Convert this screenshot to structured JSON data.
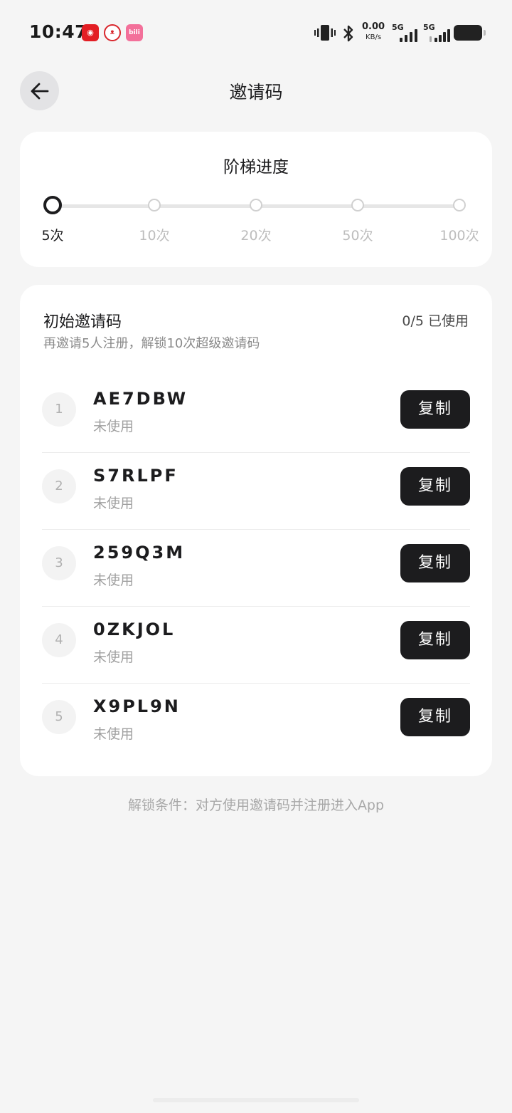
{
  "status_bar": {
    "time": "10:47",
    "apps": [
      {
        "name": "netease-music-icon",
        "glyph": "◉"
      },
      {
        "name": "cat-app-icon",
        "glyph": "ᴥ"
      },
      {
        "name": "bilibili-icon",
        "glyph": "bili"
      }
    ],
    "net_speed": "0.00",
    "net_speed_unit": "KB/s",
    "sim1": "5G",
    "sim2": "5G"
  },
  "header": {
    "title": "邀请码"
  },
  "ladder": {
    "title": "阶梯进度",
    "current_step_index": 0,
    "steps": [
      "5次",
      "10次",
      "20次",
      "50次",
      "100次"
    ]
  },
  "codes": {
    "title": "初始邀请码",
    "used_count": "0/5 已使用",
    "subtitle": "再邀请5人注册，解锁10次超级邀请码",
    "copy_label": "复制",
    "items": [
      {
        "index": "1",
        "code": "AE7DBW",
        "status": "未使用"
      },
      {
        "index": "2",
        "code": "S7RLPF",
        "status": "未使用"
      },
      {
        "index": "3",
        "code": "259Q3M",
        "status": "未使用"
      },
      {
        "index": "4",
        "code": "0ZKJOL",
        "status": "未使用"
      },
      {
        "index": "5",
        "code": "X9PL9N",
        "status": "未使用"
      }
    ]
  },
  "footnote": "解锁条件：对方使用邀请码并注册进入App",
  "colors": {
    "background": "#f5f5f5",
    "card": "#ffffff",
    "primary_dark": "#1c1c1e",
    "muted_text": "#a0a0a0"
  }
}
